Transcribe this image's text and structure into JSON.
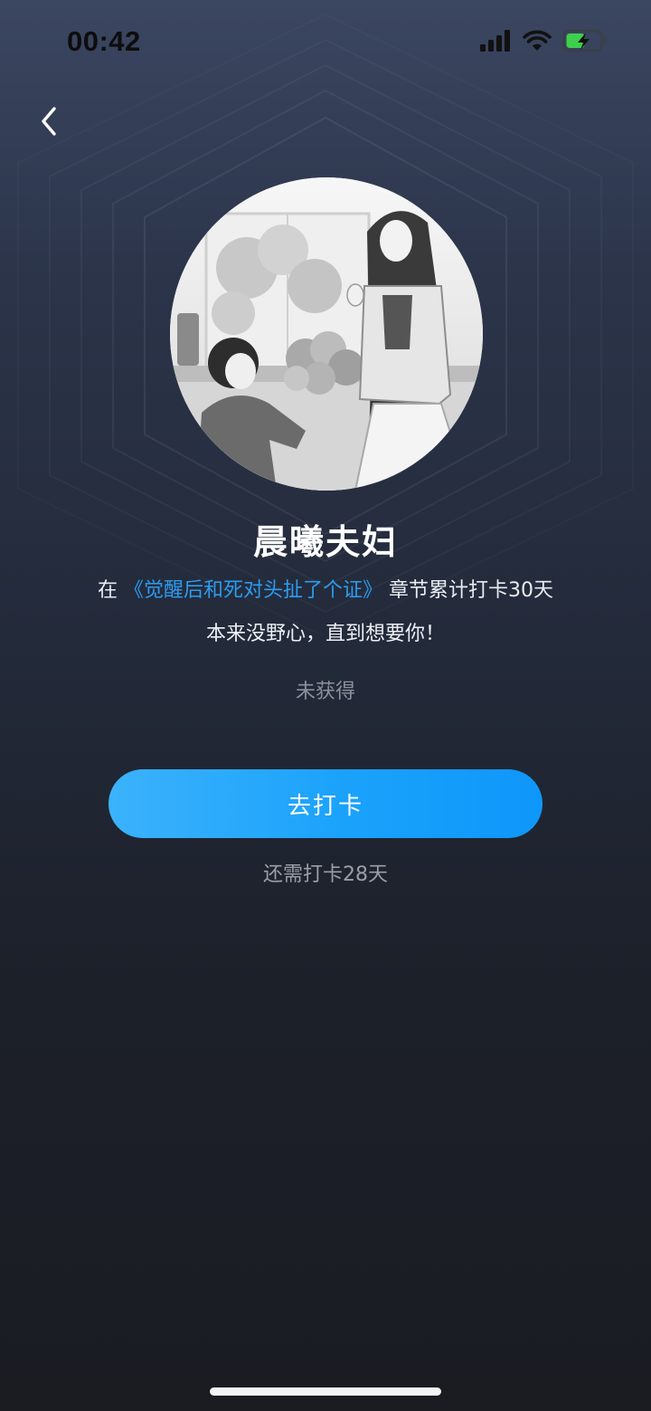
{
  "status_bar": {
    "time": "00:42",
    "icons": [
      "signal-icon",
      "wifi-icon",
      "battery-charging-icon"
    ]
  },
  "nav": {
    "back_icon": "chevron-left-icon"
  },
  "badge": {
    "image": "illustration-couple-flowers",
    "title": "晨曦夫妇",
    "desc_prefix": "在",
    "book_title": "《觉醒后和死对头扯了个证》",
    "desc_suffix": "章节累计打卡30天",
    "slogan": "本来没野心，直到想要你！",
    "status": "未获得"
  },
  "action": {
    "checkin_label": "去打卡",
    "remaining_text": "还需打卡28天"
  },
  "colors": {
    "accent": "#1aa2fb",
    "link": "#2c9cf0",
    "bg_top": "#3b4661",
    "bg_bottom": "#1a1c22"
  }
}
